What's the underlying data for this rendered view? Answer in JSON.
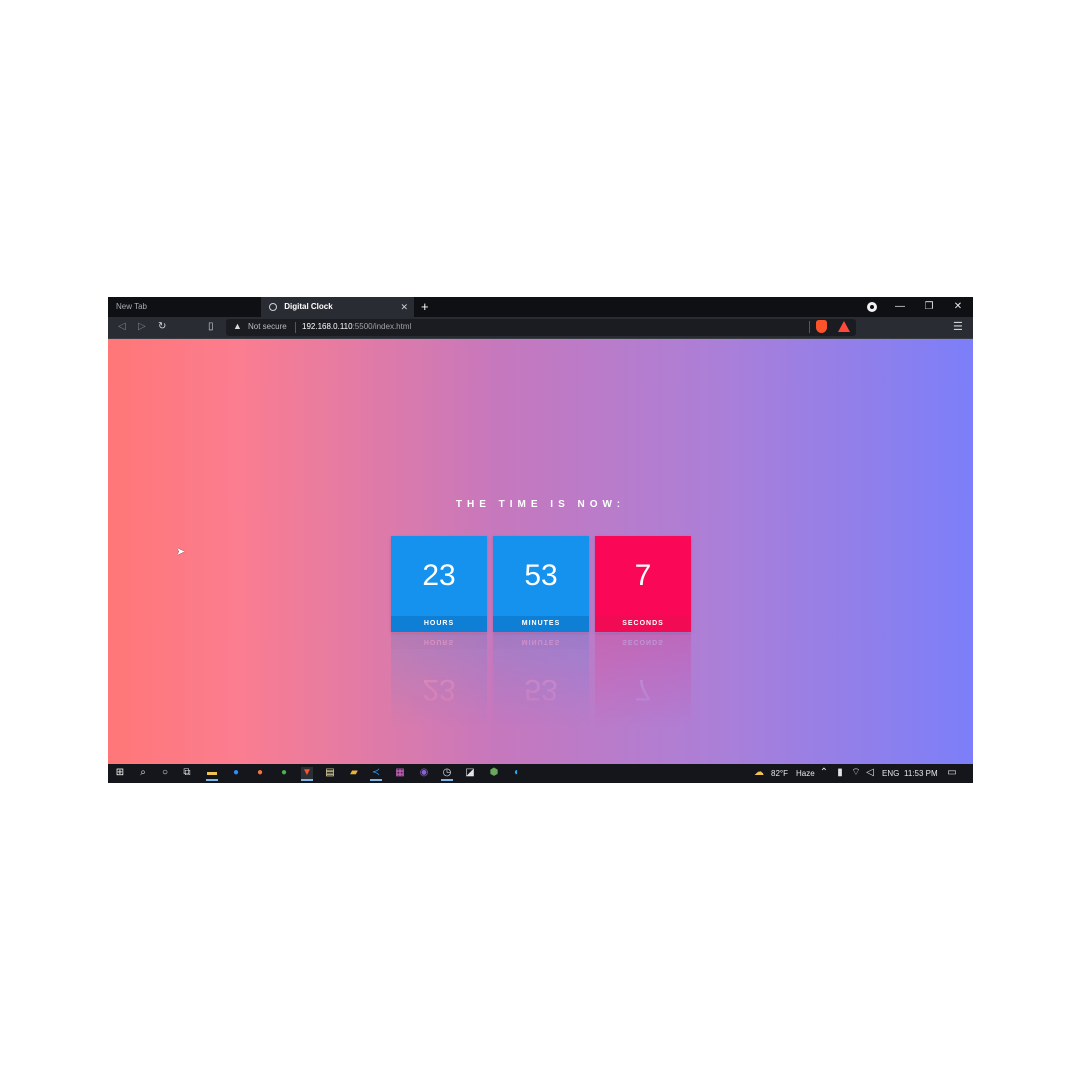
{
  "browser": {
    "tabs": [
      {
        "title": "New Tab",
        "active": false
      },
      {
        "title": "Digital Clock",
        "active": true
      }
    ],
    "new_tab_symbol": "+",
    "close_symbol": "✕",
    "window_controls": {
      "minimize": "—",
      "restore": "❐",
      "close": "✕"
    },
    "address": {
      "security_label": "Not secure",
      "host": "192.168.0.110",
      "rest": ":5500/index.html"
    }
  },
  "page": {
    "headline": "THE TIME IS NOW:",
    "units": [
      {
        "value": "23",
        "label": "HOURS",
        "color": "#1592ee"
      },
      {
        "value": "53",
        "label": "MINUTES",
        "color": "#1592ee"
      },
      {
        "value": "7",
        "label": "SECONDS",
        "color": "#fb0758"
      }
    ]
  },
  "taskbar": {
    "weather_temp": "82°F",
    "weather_desc": "Haze",
    "language": "ENG",
    "time": "11:53 PM"
  },
  "colors": {
    "gradient_start": "#ff7777",
    "gradient_end": "#7c7ff9",
    "blue_card": "#1592ee",
    "pink_card": "#fb0758"
  }
}
